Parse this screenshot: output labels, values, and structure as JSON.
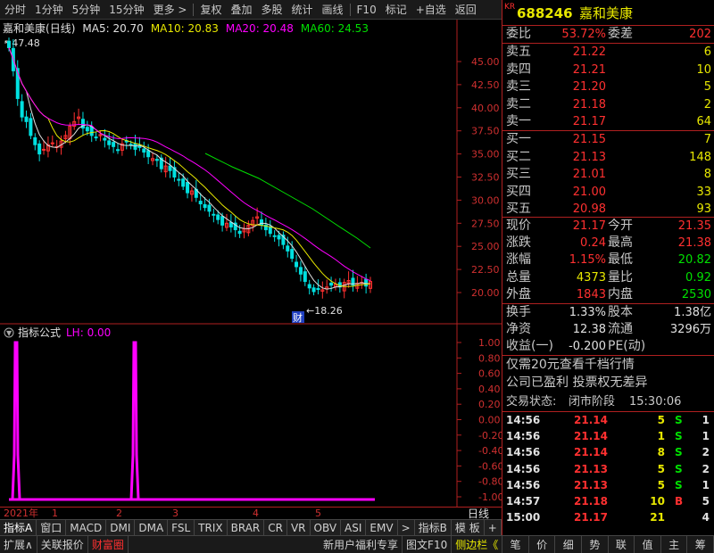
{
  "toolbar": {
    "items": [
      "分时",
      "1分钟",
      "5分钟",
      "15分钟",
      "更多 >",
      "复权",
      "叠加",
      "多股",
      "统计",
      "画线",
      "F10",
      "标记",
      "+自选",
      "返回"
    ]
  },
  "chart": {
    "stock_name": "嘉和美康",
    "period": "(日线)",
    "ma": [
      {
        "label": "MA5: 20.70",
        "color": "#e0e0e0"
      },
      {
        "label": "MA10: 20.83",
        "color": "#e8e800"
      },
      {
        "label": "MA20: 20.48",
        "color": "#ff00ff"
      },
      {
        "label": "MA60: 24.53",
        "color": "#00e000"
      }
    ],
    "high_label": "47.48",
    "low_label": "18.26",
    "finance_marker": "财",
    "y_ticks": [
      "45.00",
      "42.50",
      "40.00",
      "37.50",
      "35.00",
      "32.50",
      "30.00",
      "27.50",
      "25.00",
      "22.50",
      "20.00"
    ]
  },
  "indicator": {
    "title": "指标公式",
    "lh": "LH: 0.00",
    "y_ticks": [
      "1.00",
      "0.80",
      "0.60",
      "0.40",
      "0.20",
      "0.00",
      "-0.20",
      "-0.40",
      "-0.60",
      "-0.80",
      "-1.00"
    ]
  },
  "time_axis": {
    "labels": [
      "2021年",
      "1",
      "2",
      "3",
      "4",
      "5"
    ],
    "period_button": "日线"
  },
  "tabs": [
    "指标A",
    "窗口",
    "MACD",
    "DMI",
    "DMA",
    "FSL",
    "TRIX",
    "BRAR",
    "CR",
    "VR",
    "OBV",
    "ASI",
    "EMV",
    ">",
    "指标B",
    "模 板",
    "+",
    "-"
  ],
  "statusbar": {
    "left": [
      "扩展∧",
      "关联报价",
      "财富圈"
    ],
    "right": [
      "新用户福利专享",
      "图文F10",
      "侧边栏《"
    ],
    "panel_tabs": [
      "笔",
      "价",
      "细",
      "势",
      "联",
      "值",
      "主",
      "筹"
    ]
  },
  "quote": {
    "code": "688246",
    "name": "嘉和美康",
    "kr_badge": "KR",
    "weibi_label": "委比",
    "weibi": "53.72%",
    "weicha_label": "委差",
    "weicha": "202",
    "asks": [
      {
        "label": "卖五",
        "price": "21.22",
        "vol": "6"
      },
      {
        "label": "卖四",
        "price": "21.21",
        "vol": "10"
      },
      {
        "label": "卖三",
        "price": "21.20",
        "vol": "5"
      },
      {
        "label": "卖二",
        "price": "21.18",
        "vol": "2"
      },
      {
        "label": "卖一",
        "price": "21.17",
        "vol": "64"
      }
    ],
    "bids": [
      {
        "label": "买一",
        "price": "21.15",
        "vol": "7"
      },
      {
        "label": "买二",
        "price": "21.13",
        "vol": "148"
      },
      {
        "label": "买三",
        "price": "21.01",
        "vol": "8"
      },
      {
        "label": "买四",
        "price": "21.00",
        "vol": "33"
      },
      {
        "label": "买五",
        "price": "20.98",
        "vol": "93"
      }
    ],
    "stats": [
      {
        "l1": "现价",
        "v1": "21.17",
        "c1": "red",
        "l2": "今开",
        "v2": "21.35",
        "c2": "red"
      },
      {
        "l1": "涨跌",
        "v1": "0.24",
        "c1": "red",
        "l2": "最高",
        "v2": "21.38",
        "c2": "red"
      },
      {
        "l1": "涨幅",
        "v1": "1.15%",
        "c1": "red",
        "l2": "最低",
        "v2": "20.82",
        "c2": "green"
      },
      {
        "l1": "总量",
        "v1": "4373",
        "c1": "yellow",
        "l2": "量比",
        "v2": "0.92",
        "c2": "green"
      },
      {
        "l1": "外盘",
        "v1": "1843",
        "c1": "red",
        "l2": "内盘",
        "v2": "2530",
        "c2": "green"
      }
    ],
    "fund": [
      {
        "l1": "换手",
        "v1": "1.33%",
        "l2": "股本",
        "v2": "1.38亿"
      },
      {
        "l1": "净资",
        "v1": "12.38",
        "l2": "流通",
        "v2": "3296万"
      },
      {
        "l1": "收益(一)",
        "v1": "-0.200",
        "l2": "PE(动)",
        "v2": ""
      }
    ],
    "promo": "仅需20元查看千档行情",
    "notice": "公司已盈利 投票权无差异",
    "trade_status_label": "交易状态:",
    "trade_status": "闭市阶段",
    "trade_time": "15:30:06",
    "ticks": [
      {
        "time": "14:56",
        "price": "21.14",
        "vol": "5",
        "side": "S",
        "n": "1"
      },
      {
        "time": "14:56",
        "price": "21.14",
        "vol": "1",
        "side": "S",
        "n": "1"
      },
      {
        "time": "14:56",
        "price": "21.14",
        "vol": "8",
        "side": "S",
        "n": "2"
      },
      {
        "time": "14:56",
        "price": "21.13",
        "vol": "5",
        "side": "S",
        "n": "2"
      },
      {
        "time": "14:56",
        "price": "21.13",
        "vol": "5",
        "side": "S",
        "n": "1"
      },
      {
        "time": "14:57",
        "price": "21.18",
        "vol": "10",
        "side": "B",
        "n": "5"
      },
      {
        "time": "15:00",
        "price": "21.17",
        "vol": "21",
        "side": "",
        "n": "4"
      }
    ]
  },
  "colors": {
    "up": "#ff3030",
    "down": "#00e0e0",
    "grid": "#b02020",
    "ma60": "#00e000"
  }
}
